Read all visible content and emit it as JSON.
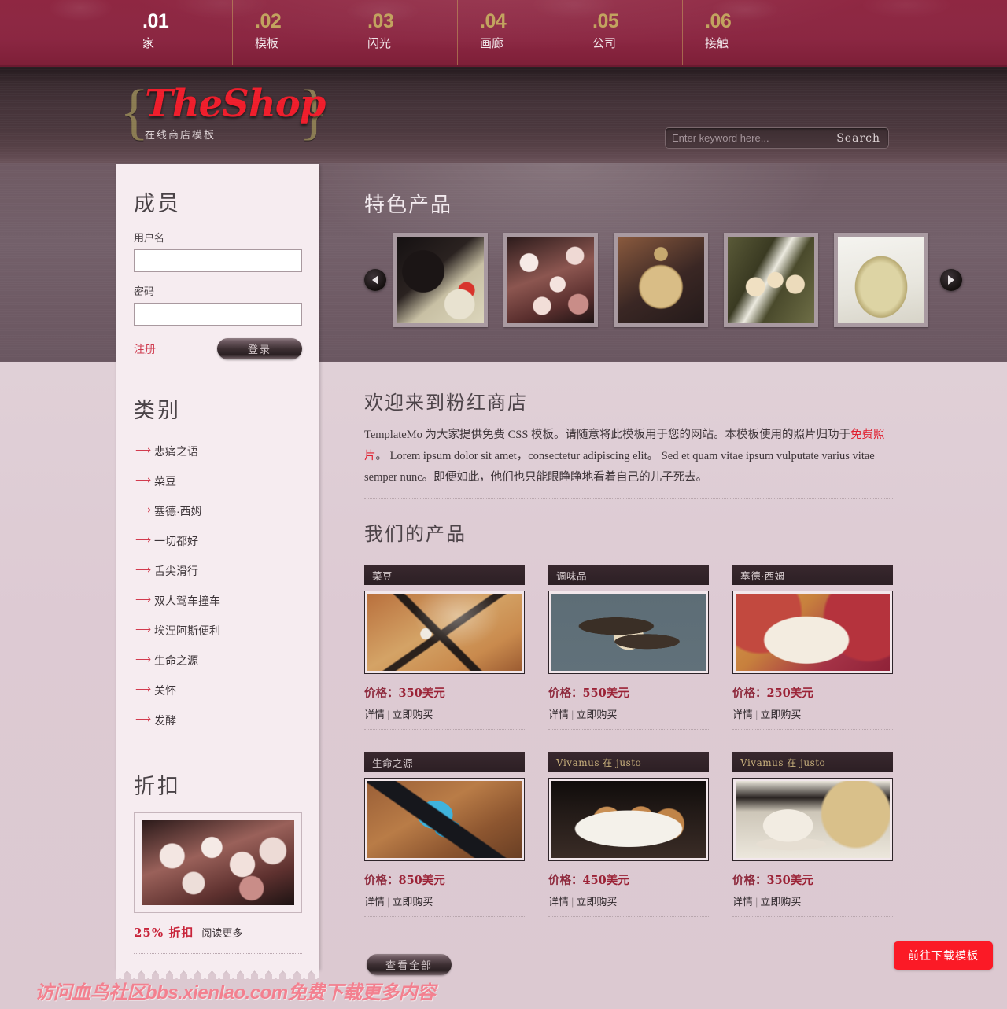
{
  "topnav": {
    "items": [
      {
        "num": ".01",
        "label": "家",
        "active": true
      },
      {
        "num": ".02",
        "label": "模板",
        "active": false
      },
      {
        "num": ".03",
        "label": "闪光",
        "active": false
      },
      {
        "num": ".04",
        "label": "画廊",
        "active": false
      },
      {
        "num": ".05",
        "label": "公司",
        "active": false
      },
      {
        "num": ".06",
        "label": "接触",
        "active": false
      }
    ]
  },
  "header": {
    "logo_the": "The",
    "logo_shop": "Shop",
    "logo_sub": "在线商店模板",
    "brace_left": "{",
    "brace_right": "}"
  },
  "search": {
    "placeholder": "Enter keyword here...",
    "value": "",
    "button_label": "Search"
  },
  "slider": {
    "title": "特色产品",
    "prev_label": "◀",
    "next_label": "▶",
    "thumbs": [
      {
        "name": "scooter-photo",
        "art": "ph-scooter"
      },
      {
        "name": "blossom-photo",
        "art": "ph-blossom"
      },
      {
        "name": "gold-plate-photo",
        "art": "ph-plate"
      },
      {
        "name": "orchid-photo",
        "art": "ph-orchid"
      },
      {
        "name": "apple-photo",
        "art": "ph-apple"
      }
    ]
  },
  "sidebar": {
    "member": {
      "title": "成员",
      "username_label": "用户名",
      "username_value": "",
      "password_label": "密码",
      "password_value": "",
      "register_label": "注册",
      "login_label": "登录"
    },
    "categories": {
      "title": "类别",
      "items": [
        "悲痛之语",
        "菜豆",
        "塞德·西姆",
        "一切都好",
        "舌尖滑行",
        "双人驾车撞车",
        "埃涅阿斯便利",
        "生命之源",
        "关怀",
        "发酵"
      ]
    },
    "discount": {
      "title": "折扣",
      "percent_text": "25% 折扣",
      "read_more": "阅读更多"
    }
  },
  "welcome": {
    "title": "欢迎来到粉红商店",
    "text_before": "TemplateMo 为大家提供免费 CSS 模板。请随意将此模板用于您的网站。本模板使用的照片归功于",
    "link": "免费照片",
    "text_after": "。 Lorem ipsum dolor sit amet，consectetur adipiscing elit。 Sed et quam vitae ipsum vulputate varius vitae semper nunc。即便如此，他们也只能眼睁睁地看着自己的儿子死去。"
  },
  "products": {
    "title": "我们的产品",
    "detail_label": "详情",
    "buy_label": "立即购买",
    "separator": "|",
    "price_prefix": "价格：",
    "items": [
      {
        "title": "菜豆",
        "gold": false,
        "price": "350美元",
        "art": "ph-clip"
      },
      {
        "title": "调味品",
        "gold": false,
        "price": "550美元",
        "art": "ph-bird"
      },
      {
        "title": "塞德·西姆",
        "gold": false,
        "price": "250美元",
        "art": "ph-dessert"
      },
      {
        "title": "生命之源",
        "gold": false,
        "price": "850美元",
        "art": "ph-butterfly"
      },
      {
        "title": "Vivamus 在 justo",
        "gold": true,
        "price": "450美元",
        "art": "ph-pastry"
      },
      {
        "title": "Vivamus 在 justo",
        "gold": true,
        "price": "350美元",
        "art": "ph-bear"
      }
    ]
  },
  "footer": {
    "view_all_label": "查看全部",
    "download_label": "前往下载模板",
    "watermark": "访问血鸟社区bbs.xienlao.com免费下载更多内容"
  },
  "colors": {
    "nav_bg": "#8d2843",
    "nav_num": "#c2a35f",
    "brand_red": "#ef1d2b",
    "accent_link": "#cf3a4e",
    "price": "#9b2236",
    "download_btn": "#fb1a26",
    "sidebar_bg": "#f6ecf0",
    "body_bg": "#dcc9d1",
    "purple_band": "#6f5a63"
  }
}
